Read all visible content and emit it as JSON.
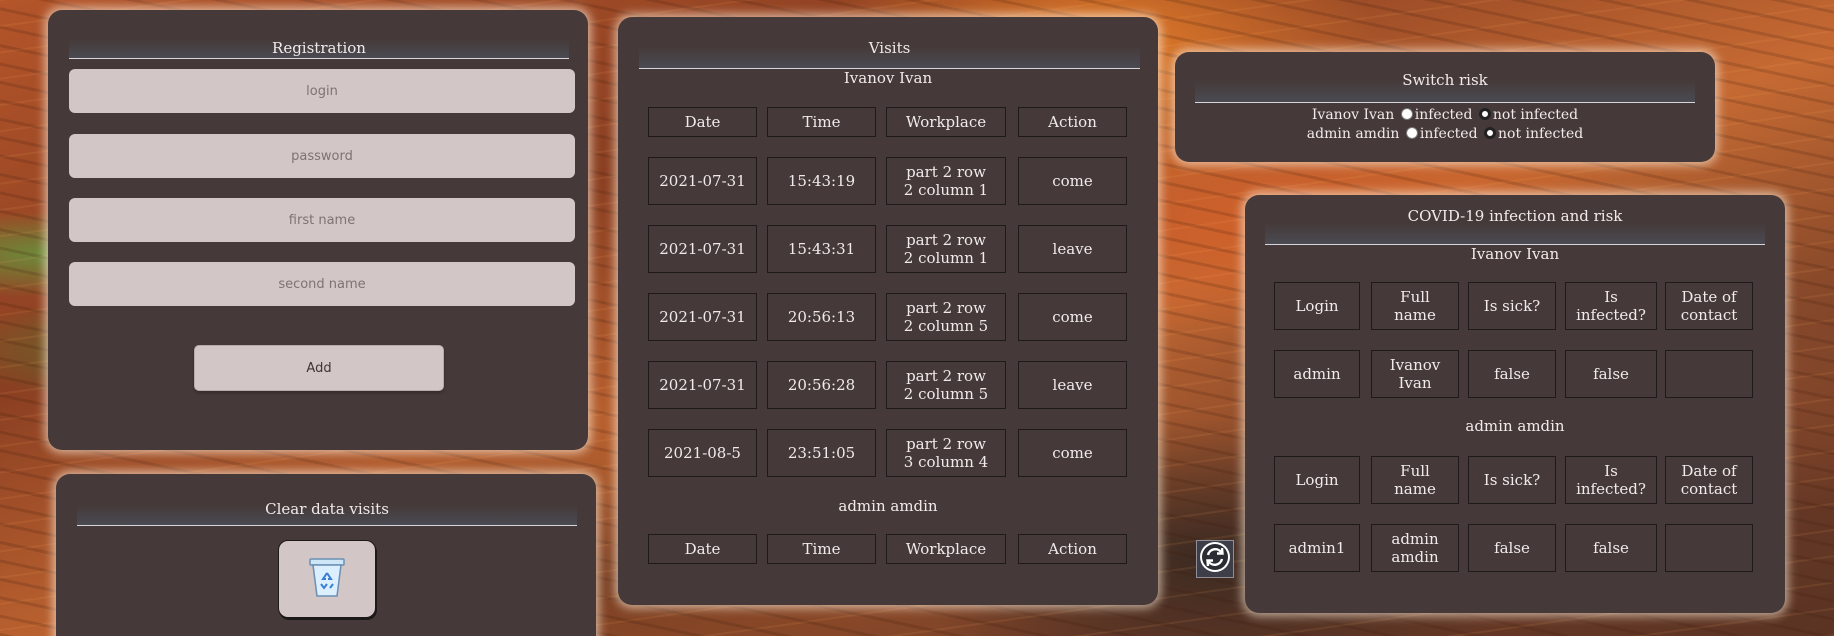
{
  "registration": {
    "title": "Registration",
    "login_placeholder": "login",
    "password_placeholder": "password",
    "first_name_placeholder": "first name",
    "second_name_placeholder": "second name",
    "add_label": "Add"
  },
  "clear_visits": {
    "title": "Clear data visits",
    "icon": "recycle-bin-icon"
  },
  "visits": {
    "title": "Visits",
    "users": [
      {
        "name": "Ivanov Ivan",
        "headers": [
          "Date",
          "Time",
          "Workplace",
          "Action"
        ],
        "rows": [
          [
            "2021-07-31",
            "15:43:19",
            "part 2 row 2 column 1",
            "come"
          ],
          [
            "2021-07-31",
            "15:43:31",
            "part 2 row 2 column 1",
            "leave"
          ],
          [
            "2021-07-31",
            "20:56:13",
            "part 2 row 2 column 5",
            "come"
          ],
          [
            "2021-07-31",
            "20:56:28",
            "part 2 row 2 column 5",
            "leave"
          ],
          [
            "2021-08-5",
            "23:51:05",
            "part 2 row 3 column 4",
            "come"
          ]
        ]
      },
      {
        "name": "admin amdin",
        "headers": [
          "Date",
          "Time",
          "Workplace",
          "Action"
        ],
        "rows": []
      }
    ]
  },
  "switch_risk": {
    "title": "Switch risk",
    "rows": [
      {
        "name": "Ivanov Ivan",
        "option1": "infected",
        "option2": "not infected",
        "selected": "not infected"
      },
      {
        "name": "admin amdin",
        "option1": "infected",
        "option2": "not infected",
        "selected": "not infected"
      }
    ]
  },
  "covid": {
    "title": "COVID-19 infection and risk",
    "users": [
      {
        "name": "Ivanov Ivan",
        "headers": [
          "Login",
          "Full name",
          "Is sick?",
          "Is infected?",
          "Date of contact"
        ],
        "row": [
          "admin",
          "Ivanov Ivan",
          "false",
          "false",
          ""
        ]
      },
      {
        "name": "admin amdin",
        "headers": [
          "Login",
          "Full name",
          "Is sick?",
          "Is infected?",
          "Date of contact"
        ],
        "row": [
          "admin1",
          "admin amdin",
          "false",
          "false",
          ""
        ]
      }
    ]
  },
  "refresh_icon": "refresh-icon",
  "colors": {
    "panel": "#453a39",
    "input": "#d2c6c6",
    "text": "#f0eaea"
  }
}
